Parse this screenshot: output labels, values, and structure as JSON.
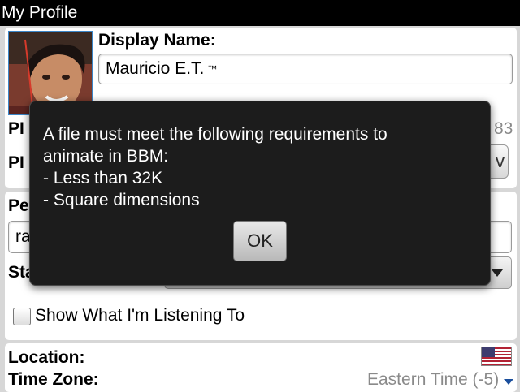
{
  "window": {
    "title": "My Profile"
  },
  "profile": {
    "display_name_label": "Display Name:",
    "display_name_value": "Mauricio E.T.",
    "display_name_tm": "™",
    "pin_label_1_partial": "PI",
    "pin_label_2_partial": "PI",
    "pin_value_partial": "83",
    "pin_button_partial": "v"
  },
  "status": {
    "personal_label_partial": "Pe",
    "personal_input_partial": "ra",
    "status_label_partial": "Sta",
    "show_listening_label": "Show What I'm Listening To",
    "show_listening_checked": false
  },
  "location": {
    "location_label": "Location:",
    "timezone_label": "Time Zone:",
    "timezone_value": "Eastern Time (-5)"
  },
  "dialog": {
    "message_lines": [
      "A file must meet the following requirements to",
      "animate in BBM:",
      "- Less than 32K",
      "- Square dimensions"
    ],
    "ok_label": "OK"
  },
  "icons": {
    "flag": "us-flag-icon",
    "scroll": "scroll-down-arrow-icon"
  },
  "colors": {
    "titlebar_bg": "#000000",
    "dialog_bg": "#1c1c1c",
    "avatar_border": "#3b86c8",
    "timezone_text": "#8a8a8a"
  }
}
